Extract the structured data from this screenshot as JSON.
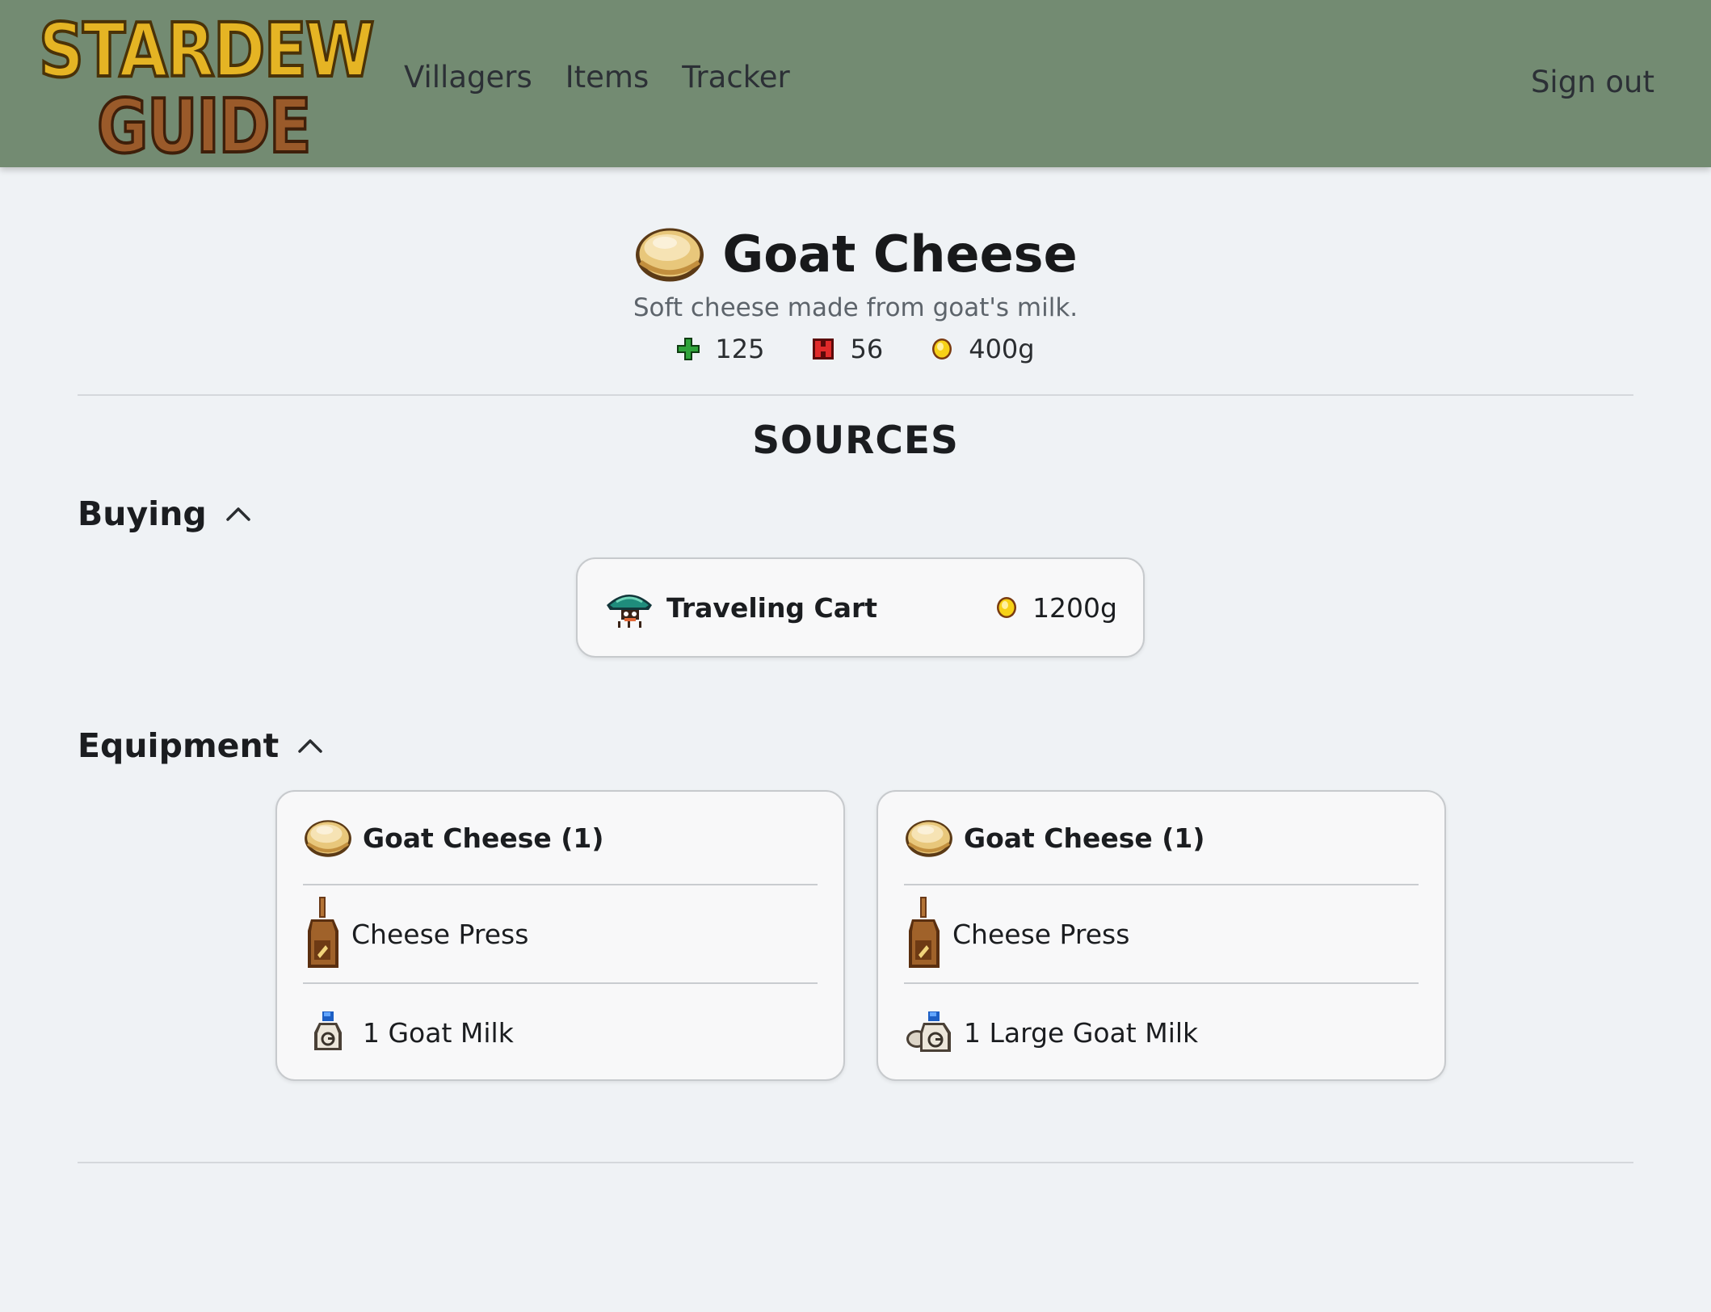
{
  "nav": {
    "logo_line1": "STARDEW",
    "logo_line2": "GUIDE",
    "links": [
      "Villagers",
      "Items",
      "Tracker"
    ],
    "sign_out": "Sign out"
  },
  "item": {
    "name": "Goat Cheese",
    "description": "Soft cheese made from goat's milk.",
    "energy": "125",
    "health": "56",
    "price": "400g"
  },
  "sources_title": "SOURCES",
  "buying": {
    "title": "Buying",
    "entries": [
      {
        "vendor": "Traveling Cart",
        "price": "1200g"
      }
    ]
  },
  "equipment": {
    "title": "Equipment",
    "recipes": [
      {
        "output": "Goat Cheese (1)",
        "machine": "Cheese Press",
        "input": "1 Goat Milk"
      },
      {
        "output": "Goat Cheese (1)",
        "machine": "Cheese Press",
        "input": "1 Large Goat Milk"
      }
    ]
  },
  "colors": {
    "navbar": "#738b72",
    "background": "#eff2f5",
    "logo_gold": "#e5b424",
    "logo_wood": "#9a5a2a"
  },
  "icons": {
    "item": "goat-cheese-icon",
    "energy": "energy-plus-icon",
    "health": "health-icon",
    "gold": "gold-coin-icon",
    "vendor": "traveling-cart-icon",
    "machine": "cheese-press-icon",
    "input_small": "goat-milk-icon",
    "input_large": "large-goat-milk-icon",
    "collapse": "chevron-up-icon"
  }
}
